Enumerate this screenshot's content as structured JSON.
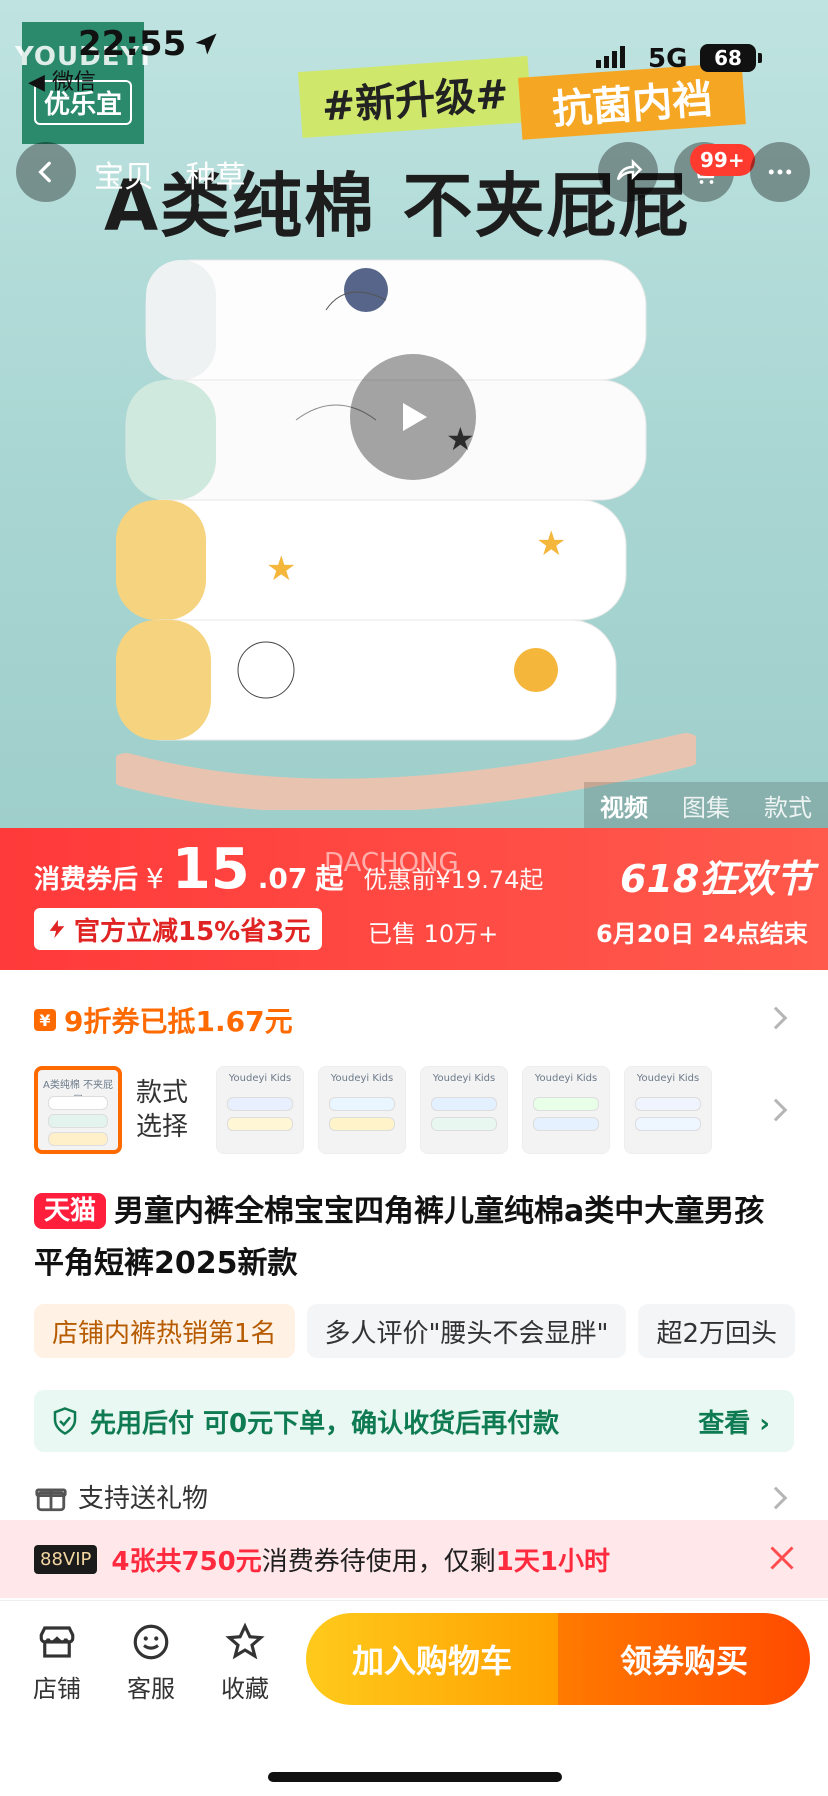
{
  "status_bar": {
    "time": "22:55",
    "network": "5G",
    "battery": "68",
    "back_app": "◀ 微信"
  },
  "hero": {
    "brand_logo_top": "YOUDEYI",
    "brand_logo_bottom": "优乐宜",
    "ribbon_1": "#新升级#",
    "ribbon_2": "抗菌内裆",
    "headline": "A类纯棉 不夹屁屁",
    "nav_tabs": [
      "宝贝",
      "种草"
    ],
    "cart_badge": "99+",
    "media_tabs": {
      "video": "视频",
      "gallery": "图集",
      "styles": "款式"
    }
  },
  "price_bar": {
    "after_coupon_label": "消费券后",
    "currency": "¥",
    "price_int": "15",
    "price_dec": ".07",
    "price_suffix": "起",
    "pre_price": "优惠前¥19.74起",
    "watermark": "DACHONG",
    "festival": "618狂欢节",
    "promo": "官方立减15%省3元",
    "sold": "已售 10万+",
    "ends": "6月20日 24点结束"
  },
  "coupon": {
    "text": "9折券已抵1.67元",
    "icon": "¥"
  },
  "style_selector": {
    "label": "款式选择",
    "thumb_brand": "Youdeyi Kids",
    "first_thumb_text": "A类纯棉 不夹屁屁"
  },
  "title": {
    "badge": "天猫",
    "text": "男童内裤全棉宝宝四角裤儿童纯棉a类中大童男孩平角短裤2025新款"
  },
  "tags": [
    "店铺内裤热销第1名",
    "多人评价\"腰头不会显胖\"",
    "超2万回头"
  ],
  "pay_later": {
    "text": "先用后付 可0元下单，确认收货后再付款",
    "view": "查看 ›"
  },
  "gift": {
    "text": "支持送礼物"
  },
  "vip": {
    "badge": "88VIP",
    "strong": "4张共750元",
    "middle": "消费券待使用，仅剩",
    "time": "1天1小时"
  },
  "bottom_bar": {
    "store": "店铺",
    "service": "客服",
    "favorite": "收藏",
    "add_to_cart": "加入购物车",
    "buy": "领券购买"
  },
  "colors": {
    "accent": "#ff3a3a",
    "orange": "#ff6a00",
    "green": "#0f7b52"
  }
}
